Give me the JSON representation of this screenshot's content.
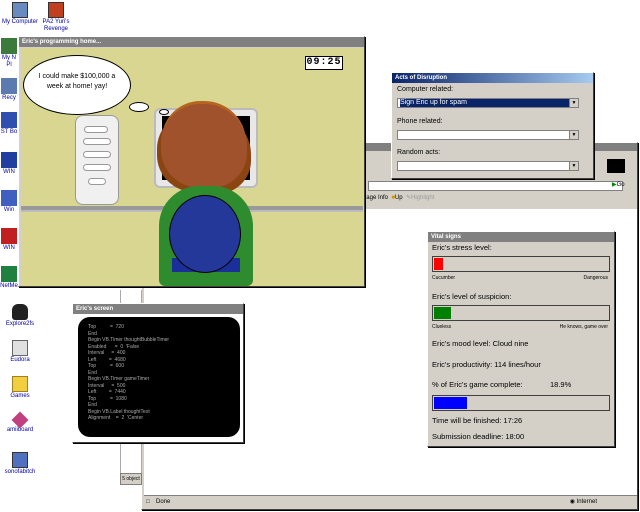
{
  "desktop_icons": [
    {
      "id": "my-computer",
      "label": "My Computer"
    },
    {
      "id": "pa2",
      "label": "PA2 Yuri's Revenge"
    },
    {
      "id": "my-network",
      "label": "My N Pl"
    },
    {
      "id": "recycle",
      "label": "Recy"
    },
    {
      "id": "st",
      "label": "ST Bo"
    },
    {
      "id": "win1",
      "label": "WIN"
    },
    {
      "id": "win2",
      "label": "Win"
    },
    {
      "id": "win3",
      "label": "WIN"
    },
    {
      "id": "netmeeting",
      "label": "NetMe"
    },
    {
      "id": "explore2fs",
      "label": "Explore2fs"
    },
    {
      "id": "eudora",
      "label": "Eudora"
    },
    {
      "id": "games",
      "label": "Games"
    },
    {
      "id": "amiiboard",
      "label": "amiiboard"
    },
    {
      "id": "sonofabitch",
      "label": "sonofabitch"
    }
  ],
  "ie": {
    "toolbar_page": "Page Info",
    "toolbar_up": "Up",
    "toolbar_highlight": "Highlight",
    "go": "Go",
    "status": "Done",
    "zone": "Internet",
    "objects": "5 object"
  },
  "game": {
    "title": "Eric's programming home...",
    "timer": "09:25",
    "thought": "I could make $100,000 a week at home! yay!"
  },
  "disruption": {
    "title": "Acts of Disruption",
    "computer_label": "Computer related:",
    "computer_value": "Sign Eric up for spam",
    "phone_label": "Phone related:",
    "phone_value": "",
    "random_label": "Random acts:",
    "random_value": ""
  },
  "screen": {
    "title": "Eric's screen",
    "code": "Top          =  720\nEnd\nBegin VB.Timer thoughtBubbleTimer\nEnabled      =  0  'False\nInterval     =  400\nLeft         =  4680\nTop          =  600\nEnd\nBegin VB.Timer gameTimer\nInterval     =  500\nLeft         =  7440\nTop          =  1080\nEnd\nBegin VB.Label thoughtText\nAlignment    =  2  'Center"
  },
  "vitals": {
    "title": "Vital signs",
    "stress_label": "Eric's stress level:",
    "stress_value": 0.05,
    "stress_min": "Cucumber",
    "stress_max": "Dangerous",
    "suspicion_label": "Eric's level of suspicion:",
    "suspicion_value": 0.1,
    "suspicion_min": "Clueless",
    "suspicion_max": "He knows, game over",
    "mood": "Eric's mood level:  Cloud nine",
    "productivity": "Eric's productivity: 114 lines/hour",
    "complete_label": "% of Eric's game complete:",
    "complete_value": "18.9%",
    "complete_fraction": 0.189,
    "finish": "Time will be finished:   17:26",
    "deadline": "Submission deadline: 18:00"
  },
  "colors": {
    "stress": "#ff0000",
    "suspicion": "#008000",
    "progress": "#0000ff",
    "title_active": "#0a246a",
    "game_bg": "#d8d690"
  }
}
